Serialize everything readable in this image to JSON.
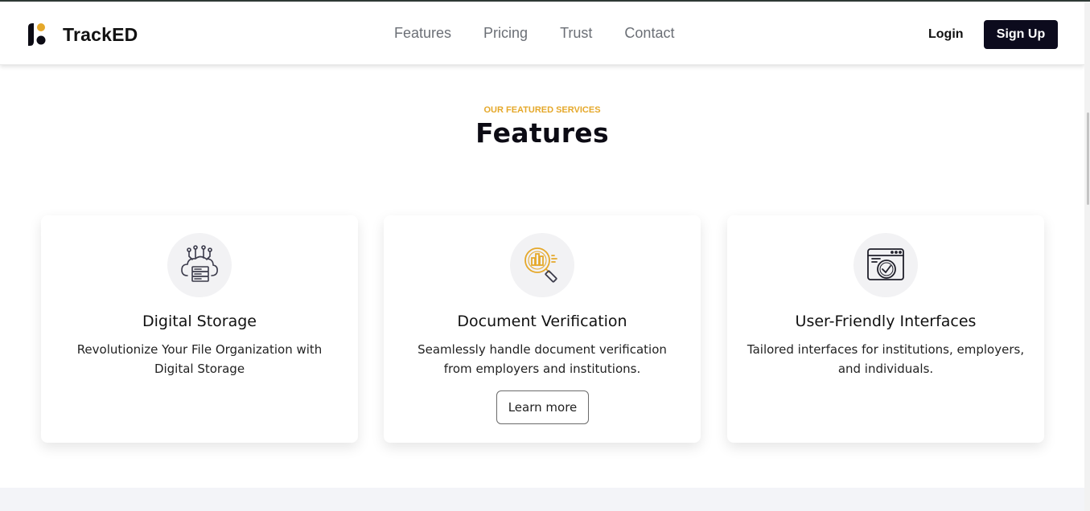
{
  "brand": {
    "name": "TrackED",
    "accent": "#e5a82a",
    "dark": "#0c0b1d"
  },
  "nav": {
    "links": [
      "Features",
      "Pricing",
      "Trust",
      "Contact"
    ],
    "login": "Login",
    "signup": "Sign Up"
  },
  "section": {
    "eyebrow": "OUR FEATURED SERVICES",
    "title": "Features"
  },
  "cards": [
    {
      "icon": "cloud-storage-icon",
      "title": "Digital Storage",
      "text": "Revolutionize Your File Organization with Digital Storage"
    },
    {
      "icon": "document-search-icon",
      "title": "Document Verification",
      "text": "Seamlessly handle document verification from employers and institutions.",
      "button": "Learn more"
    },
    {
      "icon": "interface-check-icon",
      "title": "User-Friendly Interfaces",
      "text": "Tailored interfaces for institutions, employers, and individuals."
    }
  ]
}
